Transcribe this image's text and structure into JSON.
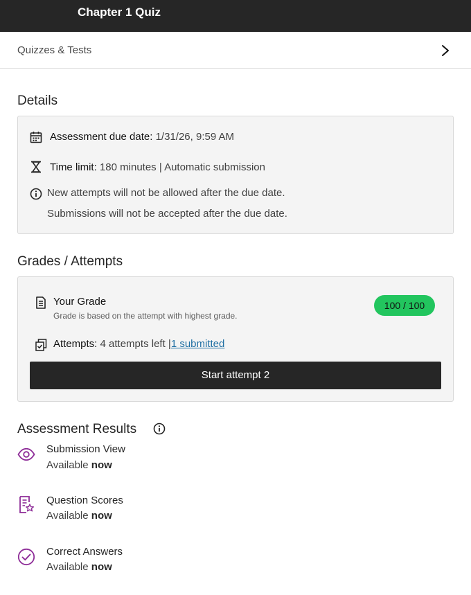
{
  "header": {
    "title": "Chapter 1 Quiz"
  },
  "breadcrumb": {
    "label": "Quizzes & Tests",
    "icon": "chevron-right-icon"
  },
  "details": {
    "heading": "Details",
    "due_label": "Assessment due date:",
    "due_value": "1/31/26, 9:59 AM",
    "time_label": "Time limit:",
    "time_value": "180 minutes | Automatic submission",
    "note_line1": "New attempts will not be allowed after the due date.",
    "note_line2": "Submissions will not be accepted after the due date."
  },
  "grades": {
    "heading": "Grades / Attempts",
    "your_grade_label": "Your Grade",
    "grade_note": "Grade is based on the attempt with highest grade.",
    "grade_value": "100 / 100",
    "attempts_label": "Attempts:",
    "attempts_left": "4 attempts left |",
    "submitted_link": "1 submitted",
    "start_button": "Start attempt 2"
  },
  "results": {
    "heading": "Assessment Results",
    "items": [
      {
        "title": "Submission View",
        "avail_prefix": "Available",
        "avail_value": "now",
        "icon": "eye-icon"
      },
      {
        "title": "Question Scores",
        "avail_prefix": "Available",
        "avail_value": "now",
        "icon": "document-star-icon"
      },
      {
        "title": "Correct Answers",
        "avail_prefix": "Available",
        "avail_value": "now",
        "icon": "check-circle-icon"
      }
    ]
  },
  "colors": {
    "topbar": "#262626",
    "badge": "#22c55e",
    "accent_purple": "#8e2d98",
    "link": "#1f6fa3"
  }
}
